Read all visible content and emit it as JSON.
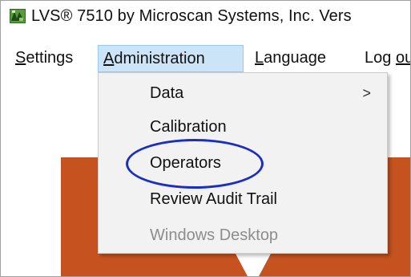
{
  "window": {
    "title": "LVS® 7510 by Microscan Systems, Inc.  Vers"
  },
  "menubar": {
    "items": [
      {
        "accel": "S",
        "rest": "ettings"
      },
      {
        "accel": "A",
        "rest": "dministration"
      },
      {
        "accel": "L",
        "rest": "anguage"
      },
      {
        "pre": "Log ",
        "accel": "o",
        "rest": "u"
      }
    ]
  },
  "dropdown": {
    "items": [
      {
        "label": "Data",
        "submenu_glyph": ">"
      },
      {
        "label": "Calibration"
      },
      {
        "label": "Operators"
      },
      {
        "label": "Review Audit Trail"
      },
      {
        "label": "Windows Desktop",
        "enabled": false
      }
    ]
  },
  "colors": {
    "menu_active_bg": "#cce4f7",
    "annotation_ellipse": "#1a2fc0",
    "background_shape": "#c5521f",
    "disabled_text": "#8d8d8d"
  }
}
